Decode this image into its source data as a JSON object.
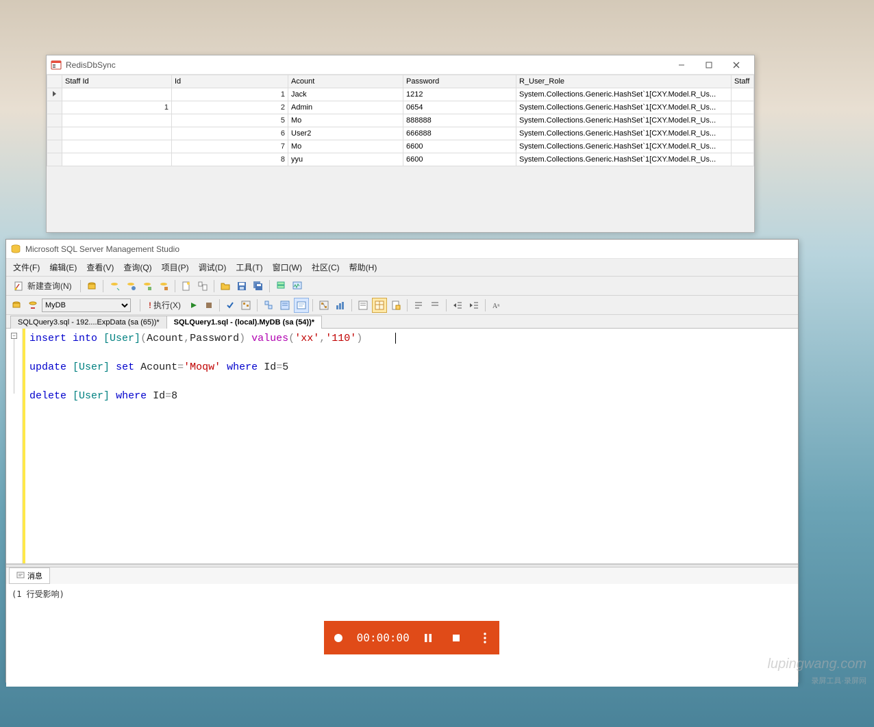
{
  "win1": {
    "title": "RedisDbSync",
    "columns": [
      "Staff Id",
      "Id",
      "Acount",
      "Password",
      "R_User_Role",
      "Staff"
    ],
    "rows": [
      {
        "sel": true,
        "staffid": "",
        "id": "1",
        "acount": "Jack",
        "password": "1212",
        "role": "System.Collections.Generic.HashSet`1[CXY.Model.R_Us...",
        "staff": ""
      },
      {
        "sel": false,
        "staffid": "1",
        "id": "2",
        "acount": "Admin",
        "password": "0654",
        "role": "System.Collections.Generic.HashSet`1[CXY.Model.R_Us...",
        "staff": ""
      },
      {
        "sel": false,
        "staffid": "",
        "id": "5",
        "acount": "Mo",
        "password": "888888",
        "role": "System.Collections.Generic.HashSet`1[CXY.Model.R_Us...",
        "staff": ""
      },
      {
        "sel": false,
        "staffid": "",
        "id": "6",
        "acount": "User2",
        "password": "666888",
        "role": "System.Collections.Generic.HashSet`1[CXY.Model.R_Us...",
        "staff": ""
      },
      {
        "sel": false,
        "staffid": "",
        "id": "7",
        "acount": "Mo",
        "password": "6600",
        "role": "System.Collections.Generic.HashSet`1[CXY.Model.R_Us...",
        "staff": ""
      },
      {
        "sel": false,
        "staffid": "",
        "id": "8",
        "acount": "yyu",
        "password": "6600",
        "role": "System.Collections.Generic.HashSet`1[CXY.Model.R_Us...",
        "staff": ""
      }
    ]
  },
  "ssms": {
    "title": "Microsoft SQL Server Management Studio",
    "menu": [
      "文件(F)",
      "编辑(E)",
      "查看(V)",
      "查询(Q)",
      "项目(P)",
      "调试(D)",
      "工具(T)",
      "窗口(W)",
      "社区(C)",
      "帮助(H)"
    ],
    "newquery": "新建查询(N)",
    "db": "MyDB",
    "execute": "执行(X)",
    "tabs": [
      {
        "label": "SQLQuery3.sql - 192....ExpData (sa (65))*",
        "active": false
      },
      {
        "label": "SQLQuery1.sql - (local).MyDB (sa (54))*",
        "active": true
      }
    ],
    "sql": {
      "l1": {
        "ins": "insert into",
        "user": "[User]",
        "lp": "(",
        "c1": "Acount",
        "cm": ",",
        "c2": "Password",
        "rp": ")",
        "val": "values",
        "s1": "'xx'",
        "s2": "'110'"
      },
      "l2": {
        "upd": "update",
        "user": "[User]",
        "set": "set",
        "col": "Acount",
        "eq": "=",
        "str": "'Moqw'",
        "wh": "where",
        "idc": "Id",
        "num": "5"
      },
      "l3": {
        "del": "delete",
        "user": "[User]",
        "wh": "where",
        "idc": "Id",
        "eq": "=",
        "num": "8"
      }
    },
    "msg_tab": "消息",
    "msg": "(1 行受影响)"
  },
  "rec": {
    "time": "00:00:00"
  },
  "watermark": {
    "line1": "lupingwang.com",
    "line2": "录屏工具·录屏网"
  }
}
